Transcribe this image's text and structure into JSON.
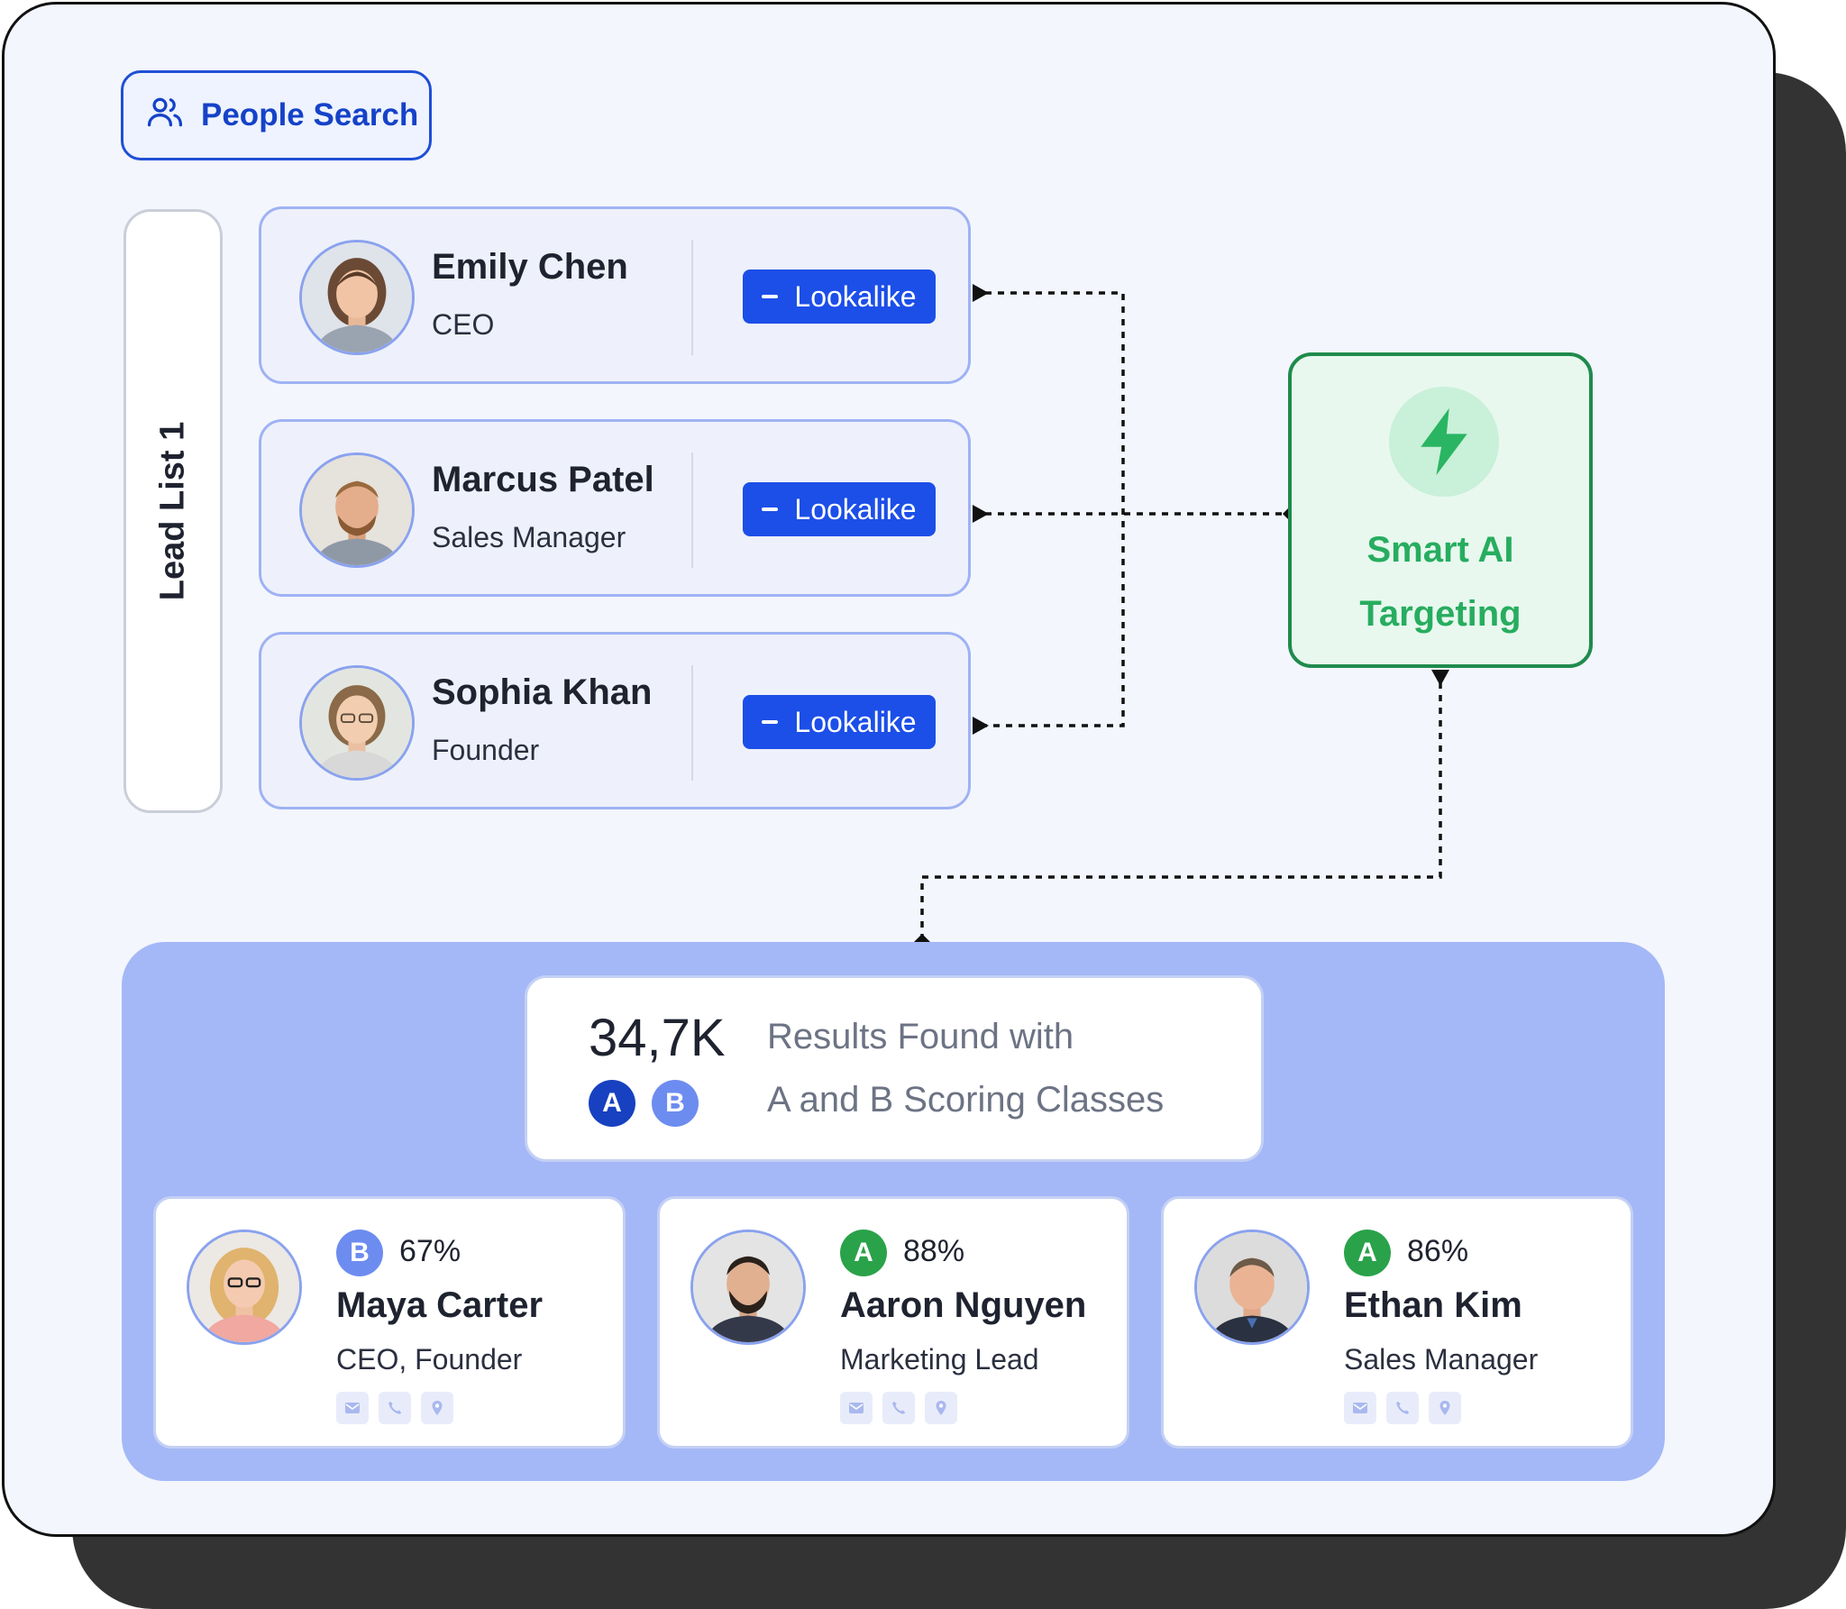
{
  "header": {
    "people_search_label": "People Search"
  },
  "lead_list": {
    "label": "Lead List 1"
  },
  "seed_leads": [
    {
      "name": "Emily Chen",
      "role": "CEO",
      "action_label": "Lookalike"
    },
    {
      "name": "Marcus Patel",
      "role": "Sales Manager",
      "action_label": "Lookalike"
    },
    {
      "name": "Sophia Khan",
      "role": "Founder",
      "action_label": "Lookalike"
    }
  ],
  "smart_ai": {
    "line1": "Smart AI",
    "line2": "Targeting"
  },
  "results": {
    "count": "34,7K",
    "line1": "Results Found with",
    "line2": "A and B Scoring Classes",
    "classes": [
      {
        "letter": "A",
        "color": "#1741c0"
      },
      {
        "letter": "B",
        "color": "#6d8cf0"
      }
    ]
  },
  "matched_leads": [
    {
      "grade": "B",
      "grade_color": "#6d8cf0",
      "score": "67%",
      "name": "Maya Carter",
      "role": "CEO, Founder"
    },
    {
      "grade": "A",
      "grade_color": "#2aa24a",
      "score": "88%",
      "name": "Aaron Nguyen",
      "role": "Marketing Lead"
    },
    {
      "grade": "A",
      "grade_color": "#2aa24a",
      "score": "86%",
      "name": "Ethan Kim",
      "role": "Sales Manager"
    }
  ],
  "colors": {
    "primary_blue": "#1c4fe8",
    "ai_green": "#27ad5f",
    "panel_blue": "#a4b8f7"
  },
  "icons": [
    "people-icon",
    "minus-icon",
    "bolt-icon",
    "mail-icon",
    "phone-icon",
    "location-icon"
  ]
}
